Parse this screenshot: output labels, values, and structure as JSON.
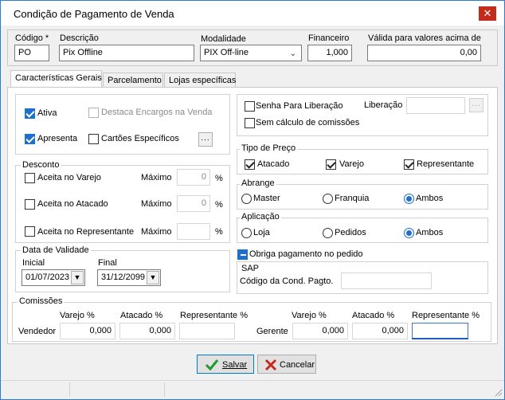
{
  "window": {
    "title": "Condição de Pagamento de Venda",
    "close": "✕"
  },
  "header": {
    "codigo_label": "Código *",
    "codigo_value": "PO",
    "descricao_label": "Descrição",
    "descricao_value": "Pix Offline",
    "modalidade_label": "Modalidade",
    "modalidade_value": "PIX Off-line",
    "financeiro_label": "Financeiro",
    "financeiro_value": "1,000",
    "valida_label": "Válida para valores acima de",
    "valida_value": "0,00"
  },
  "tabs": [
    {
      "label": "Características Gerais"
    },
    {
      "label": "Parcelamento"
    },
    {
      "label": "Lojas específicas"
    }
  ],
  "flags": {
    "ativa": "Ativa",
    "destaca": "Destaca  Encargos na Venda",
    "apresenta": "Apresenta",
    "cartoes": "Cartões Específicos",
    "dots": "..."
  },
  "desconto": {
    "title": "Desconto",
    "maximo": "Máximo",
    "percent": "%",
    "rows": [
      {
        "label": "Aceita no Varejo",
        "value": "0"
      },
      {
        "label": "Aceita no Atacado",
        "value": "0"
      },
      {
        "label": "Aceita no Representante",
        "value": ""
      }
    ]
  },
  "validade": {
    "title": "Data de Validade",
    "inicial_label": "Inicial",
    "inicial_value": "01/07/2023",
    "final_label": "Final",
    "final_value": "31/12/2099"
  },
  "right": {
    "senha": "Senha Para Liberação",
    "liberacao": "Liberação",
    "sem_calculo": "Sem cálculo de comissões",
    "dots": "...",
    "tipo_preco": {
      "title": "Tipo de Preço",
      "atacado": "Atacado",
      "varejo": "Varejo",
      "representante": "Representante"
    },
    "abrange": {
      "title": "Abrange",
      "master": "Master",
      "franquia": "Franquia",
      "ambos": "Ambos"
    },
    "aplicacao": {
      "title": "Aplicação",
      "loja": "Loja",
      "pedidos": "Pedidos",
      "ambos": "Ambos"
    },
    "obriga": "Obriga pagamento no pedido",
    "sap": {
      "title": "SAP",
      "codigo_label": "Código da Cond. Pagto."
    }
  },
  "comissoes": {
    "title": "Comissões",
    "varejo": "Varejo %",
    "atacado": "Atacado %",
    "representante": "Representante %",
    "vendedor": "Vendedor",
    "gerente": "Gerente",
    "vend_varejo": "0,000",
    "vend_atacado": "0,000",
    "vend_repr": "",
    "ger_varejo": "0,000",
    "ger_atacado": "0,000",
    "ger_repr": ""
  },
  "buttons": {
    "salvar": "Salvar",
    "cancelar": "Cancelar"
  }
}
